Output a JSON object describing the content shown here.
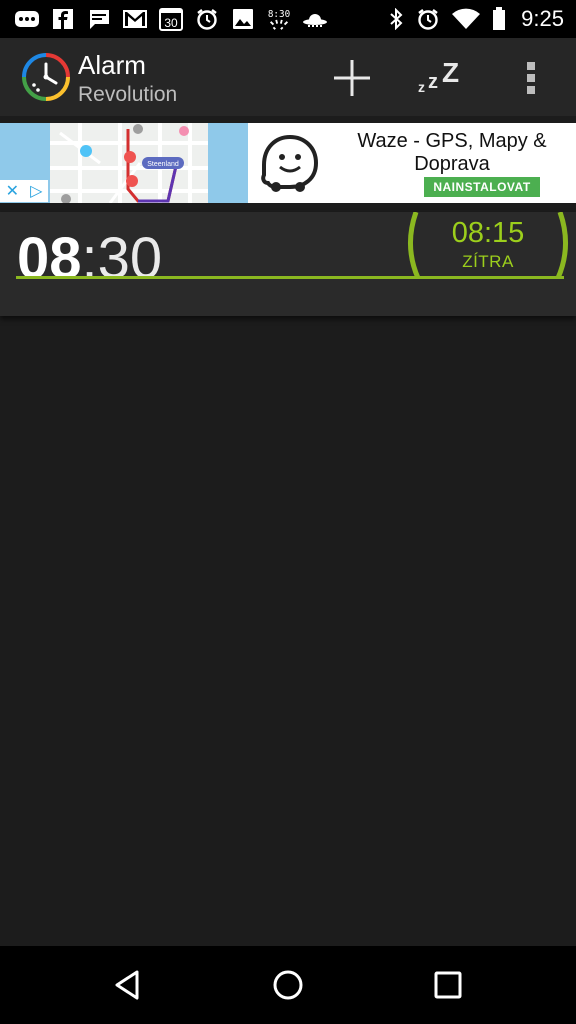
{
  "status_bar": {
    "time": "9:25",
    "icons": [
      "more-icon",
      "facebook-icon",
      "message-icon",
      "gmail-icon",
      "calendar-icon",
      "alarm-icon",
      "image-icon",
      "weather-icon",
      "ufo-icon",
      "bluetooth-icon",
      "alarm-clock-icon",
      "wifi-icon",
      "battery-icon"
    ],
    "calendar_day": "30",
    "weather_time": "8:30"
  },
  "app_bar": {
    "title": "Alarm",
    "subtitle": "Revolution",
    "snooze_label": "zZZ"
  },
  "ad": {
    "title": "Waze - GPS, Mapy & Doprava",
    "install_label": "NAINSTALOVAT",
    "map_label": "Steenland"
  },
  "alarm": {
    "hours": "08",
    "separator": ":",
    "minutes": "30",
    "next_time": "08:15",
    "next_day": "ZÍTRA",
    "accent_color": "#9ccf1c"
  }
}
